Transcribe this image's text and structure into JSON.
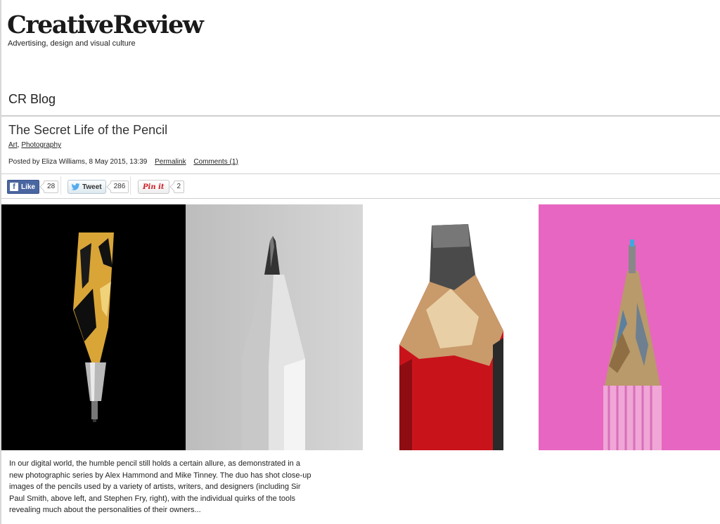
{
  "site": {
    "logo": "CreativeReview",
    "tagline": "Advertising, design and visual culture",
    "section_title": "CR Blog"
  },
  "post": {
    "title": "The Secret Life of the Pencil",
    "categories": [
      "Art",
      "Photography"
    ],
    "category_separator": ", ",
    "posted_by_prefix": "Posted by Eliza Williams, 8 May 2015, 13:39",
    "permalink_label": "Permalink",
    "comments_label": "Comments (1)",
    "excerpt": "In our digital world, the humble pencil still holds a certain allure, as demonstrated in a new photographic series by Alex Hammond and Mike Tinney. The duo has shot close-up images of the pencils used by a variety of artists, writers, and designers (including Sir Paul Smith, above left, and Stephen Fry, right), with the individual quirks of the tools revealing much about the personalities of their owners..."
  },
  "share": {
    "facebook": {
      "label": "Like",
      "count": "28",
      "icon": "facebook-icon",
      "color": "#4a66a0"
    },
    "twitter": {
      "label": "Tweet",
      "count": "286",
      "icon": "twitter-bird-icon",
      "color": "#55acee"
    },
    "pinterest": {
      "label": "Pin it",
      "count": "2",
      "icon": "pinterest-icon",
      "color": "#cb2027"
    }
  },
  "gallery": {
    "panels": [
      {
        "name": "pencil-photo-black",
        "background": "#000000"
      },
      {
        "name": "pencil-photo-grey",
        "background": "#c6c6c6"
      },
      {
        "name": "pencil-photo-red",
        "background": "#ffffff"
      },
      {
        "name": "pencil-photo-pink",
        "background": "#e766c1"
      }
    ]
  }
}
